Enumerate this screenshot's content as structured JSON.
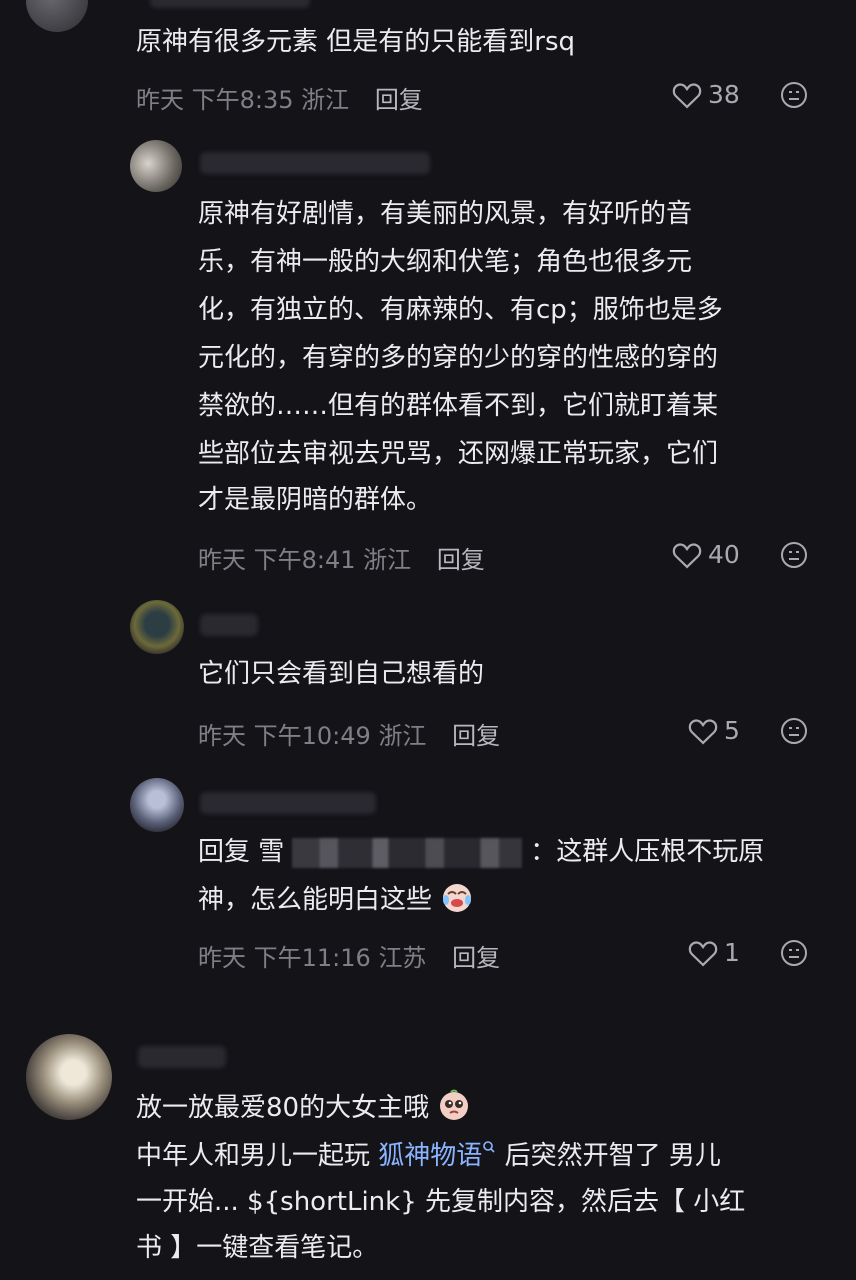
{
  "comments": [
    {
      "lines": [
        "原神有很多元素 但是有的只能看到rsq"
      ],
      "meta": {
        "time": "昨天 下午8:35",
        "location": "浙江",
        "reply": "回复"
      },
      "likes": "38"
    },
    {
      "lines": [
        "原神有好剧情，有美丽的风景，有好听的音",
        "乐，有神一般的大纲和伏笔；角色也很多元",
        "化，有独立的、有麻辣的、有cp；服饰也是多",
        "元化的，有穿的多的穿的少的穿的性感的穿的",
        "禁欲的……但有的群体看不到，它们就盯着某",
        "些部位去审视去咒骂，还网爆正常玩家，它们",
        "才是最阴暗的群体。"
      ],
      "meta": {
        "time": "昨天 下午8:41",
        "location": "浙江",
        "reply": "回复"
      },
      "likes": "40"
    },
    {
      "lines": [
        "它们只会看到自己想看的"
      ],
      "meta": {
        "time": "昨天 下午10:49",
        "location": "浙江",
        "reply": "回复"
      },
      "likes": "5"
    },
    {
      "reply_prefix": "回复",
      "reply_name_visible": "雪",
      "lines": [
        "：这群人压根不玩原",
        "神，怎么能明白这些"
      ],
      "meta": {
        "time": "昨天 下午11:16",
        "location": "江苏",
        "reply": "回复"
      },
      "likes": "1"
    },
    {
      "lines": [
        "放一放最爱80的大女主哦",
        "中年人和男儿一起玩",
        "后突然开智了 男儿",
        "一开始... ${shortLink} 先复制内容，然后去【 小红",
        "书 】一键查看笔记。"
      ],
      "link_text": "狐神物语",
      "icons": [
        "heart-icon",
        "face-icon",
        "emoji-laugh-cry-icon",
        "emoji-pleading-icon",
        "search-small-icon"
      ]
    }
  ]
}
